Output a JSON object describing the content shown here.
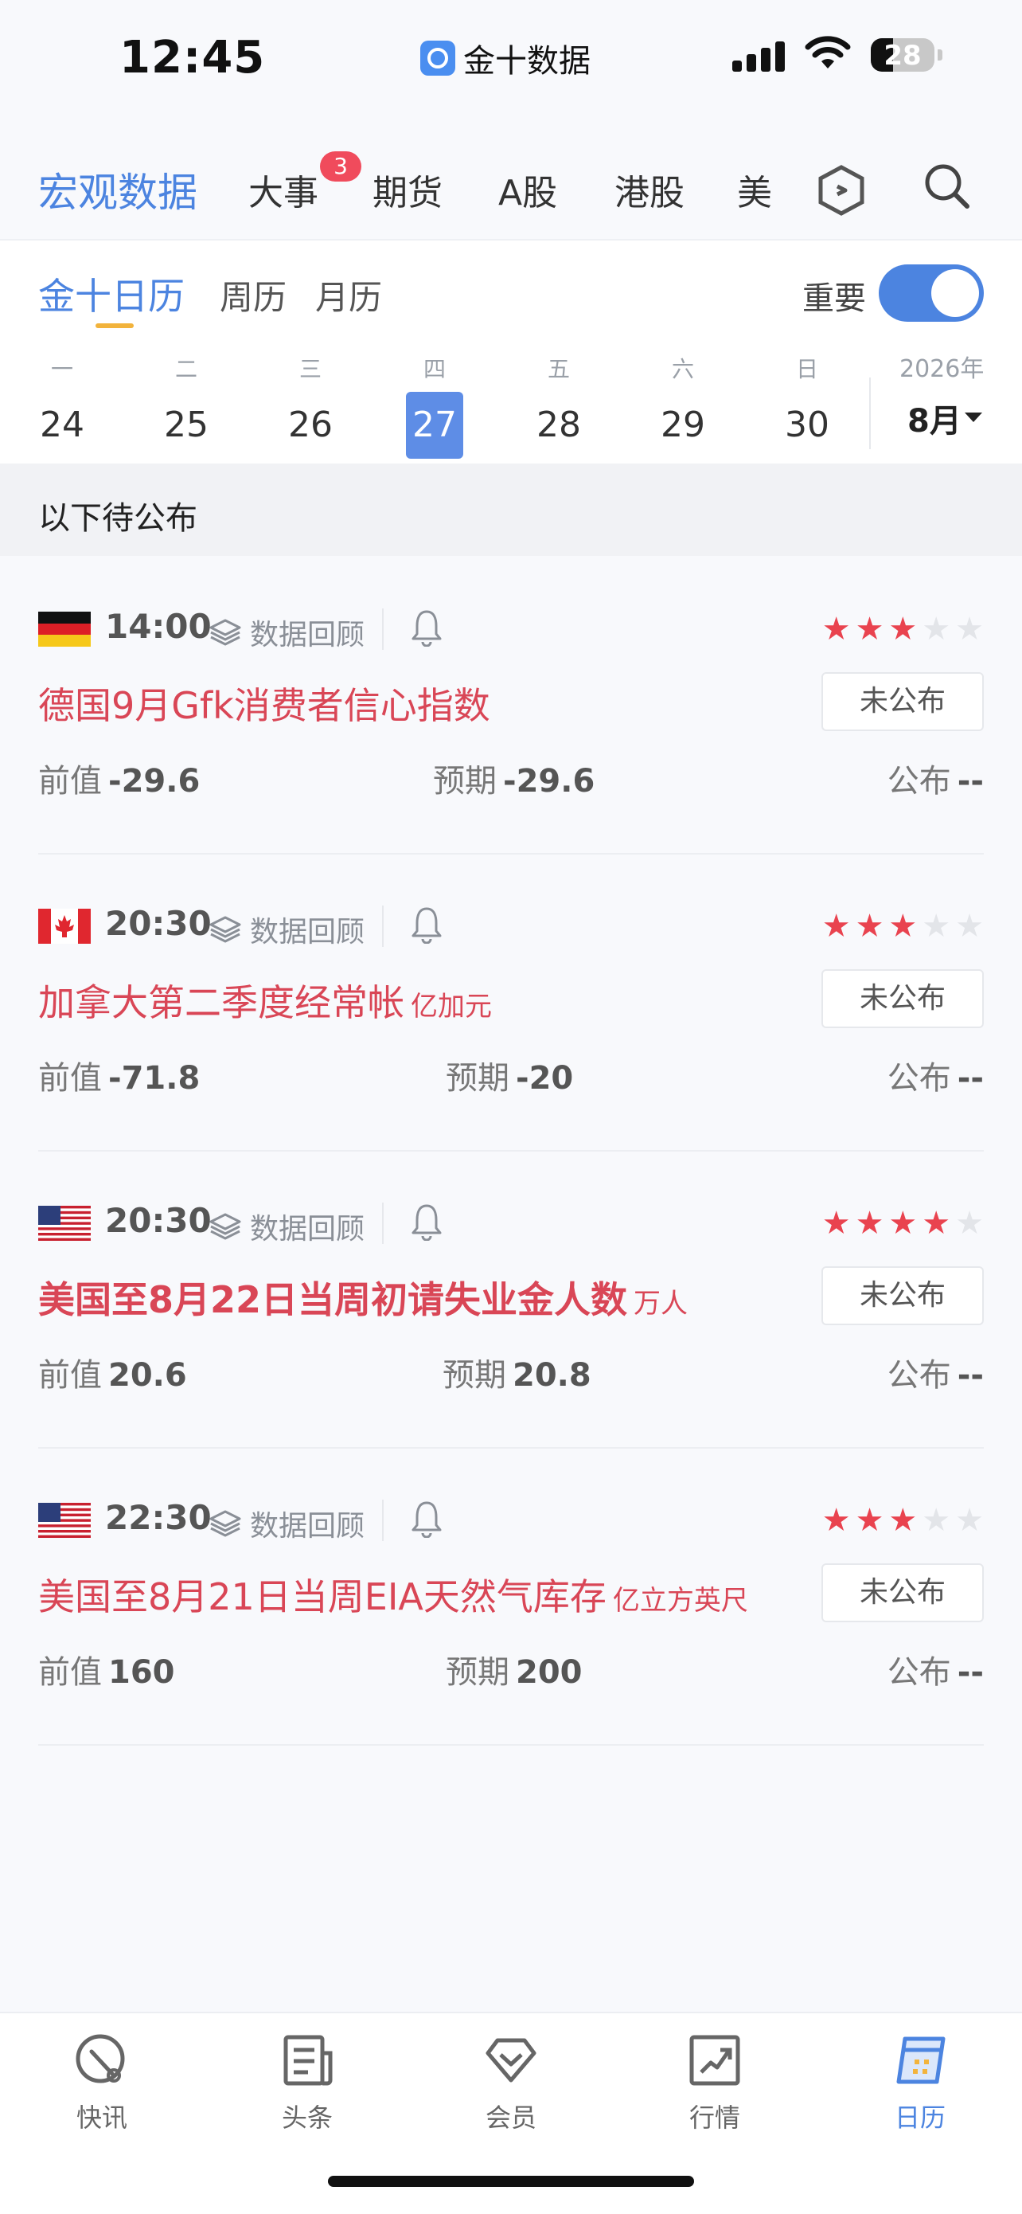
{
  "status_bar": {
    "time": "12:45",
    "app_name": "金十数据",
    "battery": "28"
  },
  "top_tabs": {
    "items": [
      "宏观数据",
      "大事",
      "期货",
      "A股",
      "港股",
      "美"
    ],
    "active": "宏观数据",
    "badge": "3"
  },
  "calendar": {
    "sub_tabs": [
      "金十日历",
      "周历",
      "月历"
    ],
    "important_label": "重要",
    "important_on": true,
    "weekdays": [
      "一",
      "二",
      "三",
      "四",
      "五",
      "六",
      "日"
    ],
    "dates": [
      "24",
      "25",
      "26",
      "27",
      "28",
      "29",
      "30"
    ],
    "selected_date": "27",
    "year": "2026年",
    "month": "8月"
  },
  "section_title": "以下待公布",
  "events": [
    {
      "country": "Germany",
      "time": "14:00",
      "review": "数据回顾",
      "title": "德国9月Gfk消费者信心指数",
      "unit": "",
      "stars": 3,
      "status": "未公布",
      "prev_label": "前值",
      "prev": "-29.6",
      "exp_label": "预期",
      "exp": "-29.6",
      "pub_label": "公布",
      "pub": "--"
    },
    {
      "country": "Canada",
      "time": "20:30",
      "review": "数据回顾",
      "title": "加拿大第二季度经常帐",
      "unit": "亿加元",
      "stars": 3,
      "status": "未公布",
      "prev_label": "前值",
      "prev": "-71.8",
      "exp_label": "预期",
      "exp": "-20",
      "pub_label": "公布",
      "pub": "--"
    },
    {
      "country": "United States",
      "time": "20:30",
      "review": "数据回顾",
      "title": "美国至8月22日当周初请失业金人数",
      "unit": "万人",
      "stars": 4,
      "status": "未公布",
      "prev_label": "前值",
      "prev": "20.6",
      "exp_label": "预期",
      "exp": "20.8",
      "pub_label": "公布",
      "pub": "--"
    },
    {
      "country": "United States",
      "time": "22:30",
      "review": "数据回顾",
      "title": "美国至8月21日当周EIA天然气库存",
      "unit": "亿立方英尺",
      "stars": 3,
      "status": "未公布",
      "prev_label": "前值",
      "prev": "160",
      "exp_label": "预期",
      "exp": "200",
      "pub_label": "公布",
      "pub": "--"
    }
  ],
  "bottom_nav": {
    "items": [
      "快讯",
      "头条",
      "会员",
      "行情",
      "日历"
    ],
    "active": "日历"
  },
  "colors": {
    "accent": "#4c84e0",
    "event_title": "#d94656",
    "star_on": "#e9434f",
    "badge": "#f04b5c"
  }
}
